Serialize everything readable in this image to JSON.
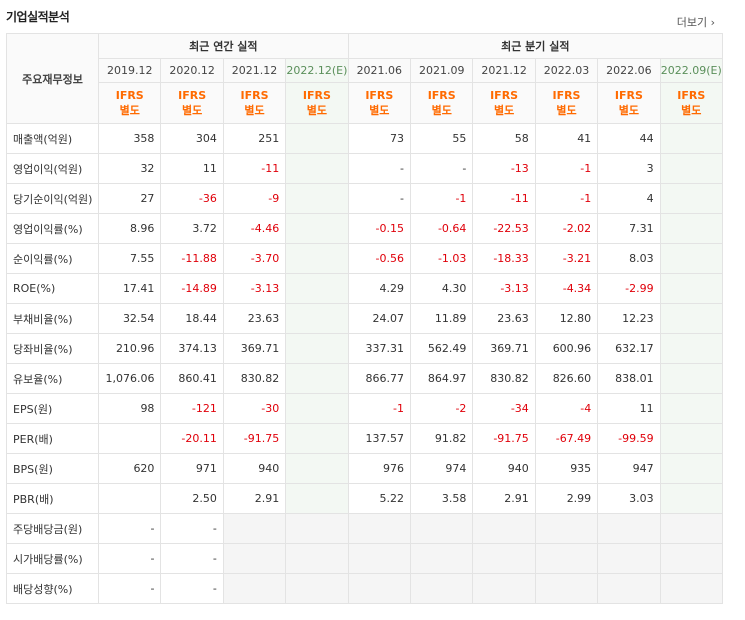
{
  "title": "기업실적분석",
  "more_label": "더보기",
  "header": {
    "row_label": "주요재무정보",
    "annual_group": "최근 연간 실적",
    "quarter_group": "최근 분기 실적",
    "ifrs_line1": "IFRS",
    "ifrs_line2": "별도",
    "periods": [
      "2019.12",
      "2020.12",
      "2021.12",
      "2022.12(E)",
      "2021.06",
      "2021.09",
      "2021.12",
      "2022.03",
      "2022.06",
      "2022.09(E)"
    ]
  },
  "rows": [
    {
      "label": "매출액(억원)",
      "values": [
        "358",
        "304",
        "251",
        "",
        "73",
        "55",
        "58",
        "41",
        "44",
        ""
      ]
    },
    {
      "label": "영업이익(억원)",
      "values": [
        "32",
        "11",
        "-11",
        "",
        "-",
        "-",
        "-13",
        "-1",
        "3",
        ""
      ]
    },
    {
      "label": "당기순이익(억원)",
      "values": [
        "27",
        "-36",
        "-9",
        "",
        "-",
        "-1",
        "-11",
        "-1",
        "4",
        ""
      ]
    },
    {
      "label": "영업이익률(%)",
      "values": [
        "8.96",
        "3.72",
        "-4.46",
        "",
        "-0.15",
        "-0.64",
        "-22.53",
        "-2.02",
        "7.31",
        ""
      ]
    },
    {
      "label": "순이익률(%)",
      "values": [
        "7.55",
        "-11.88",
        "-3.70",
        "",
        "-0.56",
        "-1.03",
        "-18.33",
        "-3.21",
        "8.03",
        ""
      ]
    },
    {
      "label": "ROE(%)",
      "values": [
        "17.41",
        "-14.89",
        "-3.13",
        "",
        "4.29",
        "4.30",
        "-3.13",
        "-4.34",
        "-2.99",
        ""
      ]
    },
    {
      "label": "부채비율(%)",
      "values": [
        "32.54",
        "18.44",
        "23.63",
        "",
        "24.07",
        "11.89",
        "23.63",
        "12.80",
        "12.23",
        ""
      ]
    },
    {
      "label": "당좌비율(%)",
      "values": [
        "210.96",
        "374.13",
        "369.71",
        "",
        "337.31",
        "562.49",
        "369.71",
        "600.96",
        "632.17",
        ""
      ]
    },
    {
      "label": "유보율(%)",
      "values": [
        "1,076.06",
        "860.41",
        "830.82",
        "",
        "866.77",
        "864.97",
        "830.82",
        "826.60",
        "838.01",
        ""
      ]
    },
    {
      "label": "EPS(원)",
      "values": [
        "98",
        "-121",
        "-30",
        "",
        "-1",
        "-2",
        "-34",
        "-4",
        "11",
        ""
      ]
    },
    {
      "label": "PER(배)",
      "values": [
        "",
        "-20.11",
        "-91.75",
        "",
        "137.57",
        "91.82",
        "-91.75",
        "-67.49",
        "-99.59",
        ""
      ]
    },
    {
      "label": "BPS(원)",
      "values": [
        "620",
        "971",
        "940",
        "",
        "976",
        "974",
        "940",
        "935",
        "947",
        ""
      ]
    },
    {
      "label": "PBR(배)",
      "values": [
        "",
        "2.50",
        "2.91",
        "",
        "5.22",
        "3.58",
        "2.91",
        "2.99",
        "3.03",
        ""
      ]
    },
    {
      "label": "주당배당금(원)",
      "values": [
        "-",
        "-",
        null,
        null,
        null,
        null,
        null,
        null,
        null,
        null
      ]
    },
    {
      "label": "시가배당률(%)",
      "values": [
        "-",
        "-",
        null,
        null,
        null,
        null,
        null,
        null,
        null,
        null
      ]
    },
    {
      "label": "배당성향(%)",
      "values": [
        "-",
        "-",
        null,
        null,
        null,
        null,
        null,
        null,
        null,
        null
      ]
    }
  ]
}
